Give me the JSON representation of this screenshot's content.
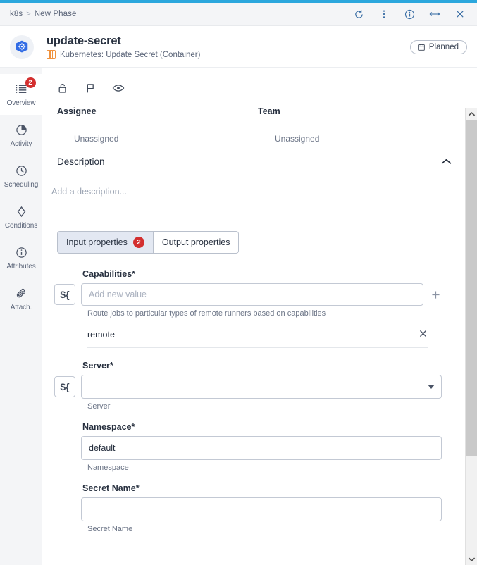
{
  "titlebar": {
    "breadcrumb_root": "k8s",
    "breadcrumb_sep": ">",
    "breadcrumb_leaf": "New Phase",
    "actions": [
      {
        "name": "refresh-icon",
        "label": "Refresh"
      },
      {
        "name": "more-vertical-icon",
        "label": "More"
      },
      {
        "name": "info-icon",
        "label": "Info"
      },
      {
        "name": "expand-horizontal-icon",
        "label": "Expand"
      },
      {
        "name": "close-icon",
        "label": "Close"
      }
    ]
  },
  "header": {
    "avatar_icon": "kubernetes-logo-icon",
    "title": "update-secret",
    "subtitle": "Kubernetes: Update Secret (Container)",
    "subtitle_icon": "container-task-icon",
    "status_badge": "Planned",
    "status_badge_icon": "calendar-icon"
  },
  "sidebar": {
    "items": [
      {
        "label": "Overview",
        "icon": "list-icon",
        "badge": "2",
        "active": true
      },
      {
        "label": "Activity",
        "icon": "pie-chart-icon",
        "badge": null,
        "active": false
      },
      {
        "label": "Scheduling",
        "icon": "clock-icon",
        "badge": null,
        "active": false
      },
      {
        "label": "Conditions",
        "icon": "diamond-icon",
        "badge": null,
        "active": false
      },
      {
        "label": "Attributes",
        "icon": "info-circle-icon",
        "badge": null,
        "active": false
      },
      {
        "label": "Attach.",
        "icon": "paperclip-icon",
        "badge": null,
        "active": false
      }
    ]
  },
  "toolbar": {
    "icons": [
      {
        "name": "unlock-icon",
        "label": "Lock"
      },
      {
        "name": "flag-icon",
        "label": "Flag"
      },
      {
        "name": "eye-icon",
        "label": "Watch"
      }
    ]
  },
  "details": {
    "assignee_label": "Assignee",
    "assignee_value": "Unassigned",
    "team_label": "Team",
    "team_value": "Unassigned"
  },
  "description": {
    "title": "Description",
    "placeholder": "Add a description...",
    "collapse_icon": "chevron-up-icon"
  },
  "tabs": [
    {
      "label": "Input properties",
      "badge": "2",
      "active": true
    },
    {
      "label": "Output properties",
      "badge": null,
      "active": false
    }
  ],
  "form": {
    "var_button_label": "${",
    "fields": [
      {
        "label": "Capabilities",
        "required": "*",
        "type": "multivalue",
        "value": "",
        "placeholder": "Add new value",
        "helper": "Route jobs to particular types of remote runners based on capabilities",
        "has_var_button": true,
        "add_icon": "plus-icon",
        "chips": [
          {
            "text": "remote",
            "remove_icon": "close-icon"
          }
        ]
      },
      {
        "label": "Server",
        "required": "*",
        "type": "select",
        "value": "",
        "placeholder": "",
        "helper": "Server",
        "has_var_button": true,
        "caret_icon": "chevron-down-icon",
        "chips": []
      },
      {
        "label": "Namespace",
        "required": "*",
        "type": "text",
        "value": "default",
        "placeholder": "",
        "helper": "Namespace",
        "has_var_button": false,
        "chips": []
      },
      {
        "label": "Secret Name",
        "required": "*",
        "type": "text",
        "value": "",
        "placeholder": "",
        "helper": "Secret Name",
        "has_var_button": false,
        "chips": []
      }
    ]
  },
  "scrollbar": {
    "up_icon": "chevron-up-icon",
    "down_icon": "chevron-down-icon"
  },
  "colors": {
    "accent": "#2ba7dd",
    "badge_red": "#d32f2f",
    "link_blue": "#3a6ea5",
    "k8s_blue": "#326ce5",
    "orange": "#f0933e"
  }
}
